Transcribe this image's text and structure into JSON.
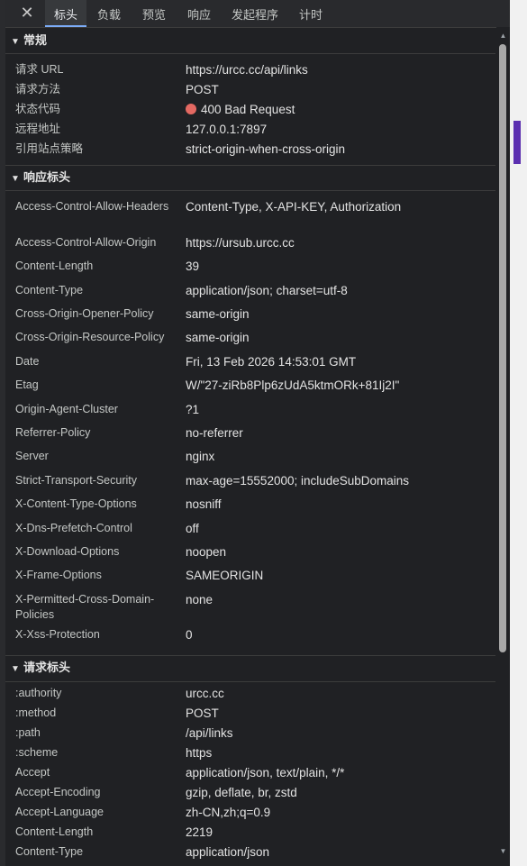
{
  "tabs": [
    {
      "label": "标头",
      "active": true
    },
    {
      "label": "负载",
      "active": false
    },
    {
      "label": "预览",
      "active": false
    },
    {
      "label": "响应",
      "active": false
    },
    {
      "label": "发起程序",
      "active": false
    },
    {
      "label": "计时",
      "active": false
    }
  ],
  "icons": {
    "close": "close-icon",
    "expand": "triangle-down-icon",
    "status": "status-dot-icon"
  },
  "colors": {
    "status_error": "#e46962",
    "active_tab_underline": "#7cacf8"
  },
  "general": {
    "title": "常规",
    "rows": [
      {
        "key": "请求 URL",
        "value": "https://urcc.cc/api/links"
      },
      {
        "key": "请求方法",
        "value": "POST"
      },
      {
        "key": "状态代码",
        "value": "400 Bad Request"
      },
      {
        "key": "远程地址",
        "value": "127.0.0.1:7897"
      },
      {
        "key": "引用站点策略",
        "value": "strict-origin-when-cross-origin"
      }
    ]
  },
  "response_headers": {
    "title": "响应标头",
    "rows": [
      {
        "key": "Access-Control-Allow-Headers",
        "value": "Content-Type, X-API-KEY, Authorization"
      },
      {
        "key": "Access-Control-Allow-Origin",
        "value": "https://ursub.urcc.cc"
      },
      {
        "key": "Content-Length",
        "value": "39"
      },
      {
        "key": "Content-Type",
        "value": "application/json; charset=utf-8"
      },
      {
        "key": "Cross-Origin-Opener-Policy",
        "value": "same-origin"
      },
      {
        "key": "Cross-Origin-Resource-Policy",
        "value": "same-origin"
      },
      {
        "key": "Date",
        "value": "Fri, 13 Feb 2026 14:53:01 GMT"
      },
      {
        "key": "Etag",
        "value": "W/\"27-ziRb8Plp6zUdA5ktmORk+81Ij2I\""
      },
      {
        "key": "Origin-Agent-Cluster",
        "value": "?1"
      },
      {
        "key": "Referrer-Policy",
        "value": "no-referrer"
      },
      {
        "key": "Server",
        "value": "nginx"
      },
      {
        "key": "Strict-Transport-Security",
        "value": "max-age=15552000; includeSubDomains"
      },
      {
        "key": "X-Content-Type-Options",
        "value": "nosniff"
      },
      {
        "key": "X-Dns-Prefetch-Control",
        "value": "off"
      },
      {
        "key": "X-Download-Options",
        "value": "noopen"
      },
      {
        "key": "X-Frame-Options",
        "value": "SAMEORIGIN"
      },
      {
        "key": "X-Permitted-Cross-Domain-Policies",
        "value": "none"
      },
      {
        "key": "X-Xss-Protection",
        "value": "0"
      }
    ]
  },
  "request_headers": {
    "title": "请求标头",
    "rows": [
      {
        "key": ":authority",
        "value": "urcc.cc"
      },
      {
        "key": ":method",
        "value": "POST"
      },
      {
        "key": ":path",
        "value": "/api/links"
      },
      {
        "key": ":scheme",
        "value": "https"
      },
      {
        "key": "Accept",
        "value": "application/json, text/plain, */*"
      },
      {
        "key": "Accept-Encoding",
        "value": "gzip, deflate, br, zstd"
      },
      {
        "key": "Accept-Language",
        "value": "zh-CN,zh;q=0.9"
      },
      {
        "key": "Content-Length",
        "value": "2219"
      },
      {
        "key": "Content-Type",
        "value": "application/json"
      }
    ]
  }
}
